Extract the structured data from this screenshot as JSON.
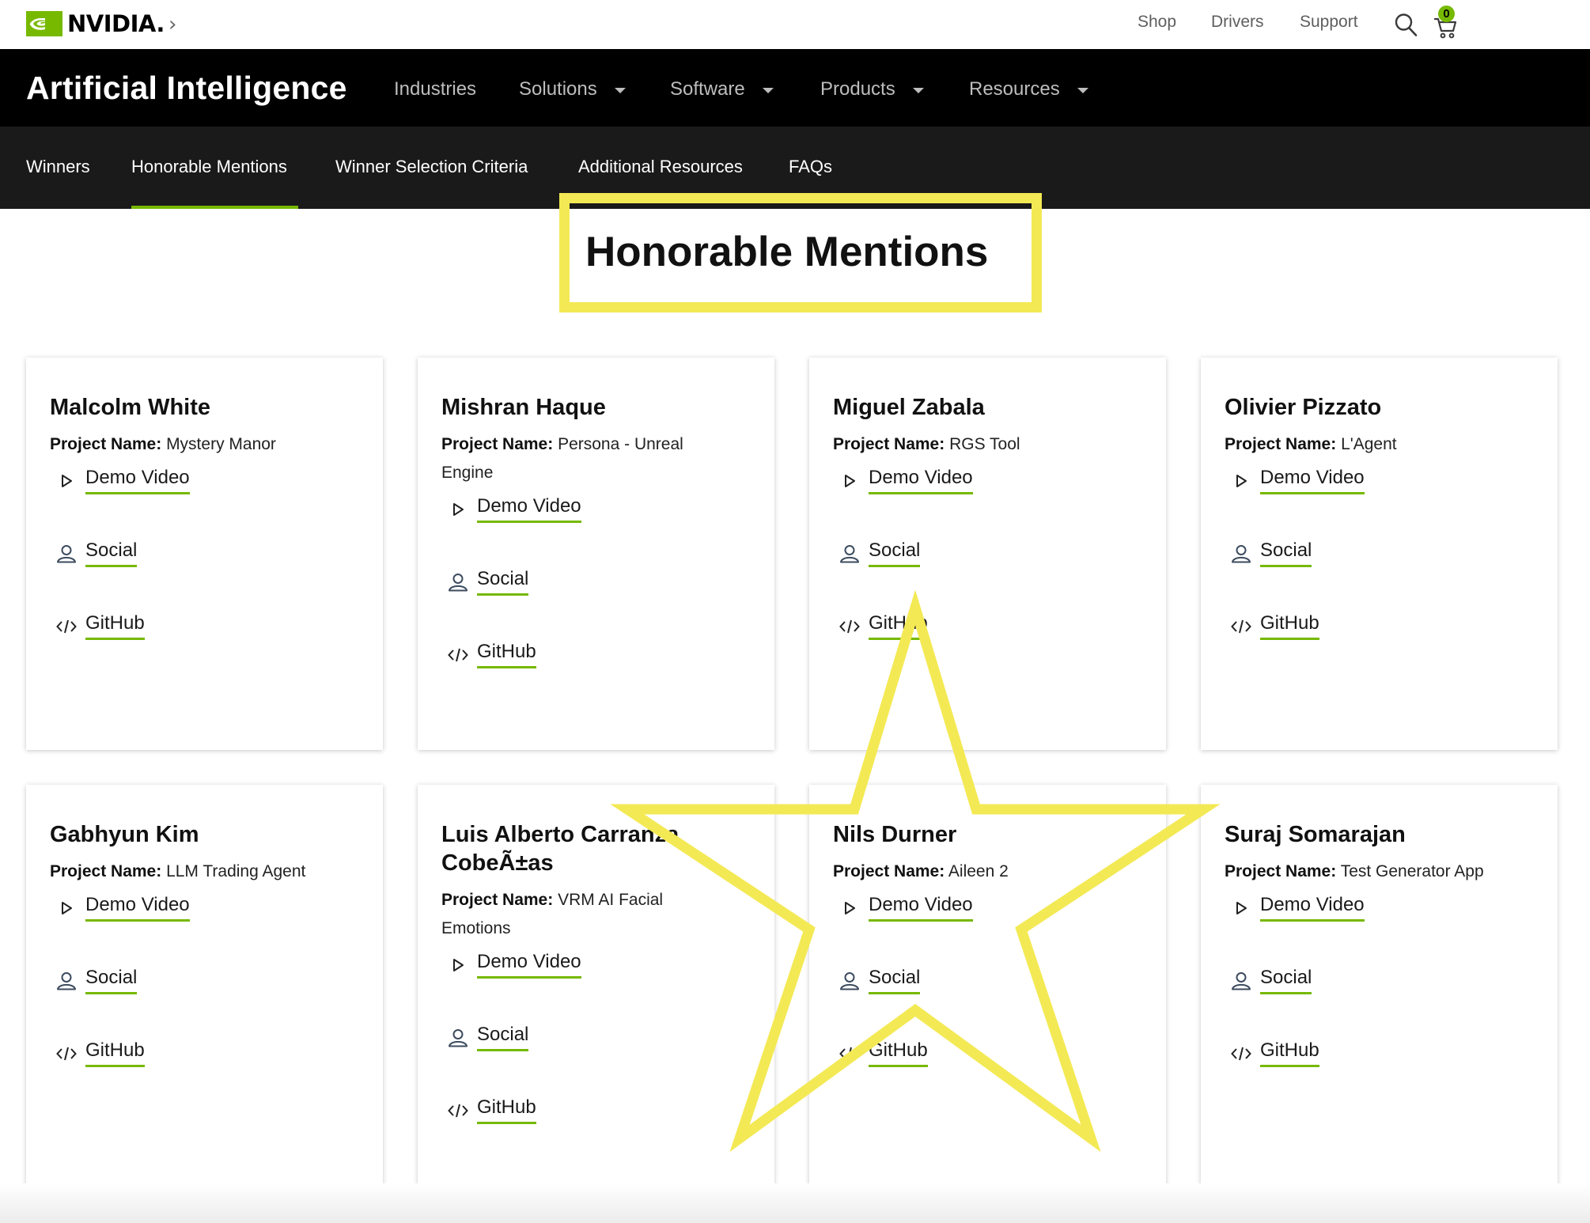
{
  "header": {
    "logo_text": "NVIDIA.",
    "breadcrumb_chevron": "›",
    "utility_links": [
      "Shop",
      "Drivers",
      "Support"
    ],
    "cart_count": "0"
  },
  "mainnav": {
    "title": "Artificial Intelligence",
    "items": [
      {
        "label": "Industries",
        "has_dropdown": false
      },
      {
        "label": "Solutions",
        "has_dropdown": true
      },
      {
        "label": "Software",
        "has_dropdown": true
      },
      {
        "label": "Products",
        "has_dropdown": true
      },
      {
        "label": "Resources",
        "has_dropdown": true
      }
    ]
  },
  "subnav": {
    "items": [
      "Winners",
      "Honorable Mentions",
      "Winner Selection Criteria",
      "Additional Resources",
      "FAQs"
    ],
    "active": "Honorable Mentions"
  },
  "page": {
    "title": "Honorable Mentions"
  },
  "labels": {
    "project_name": "Project Name:",
    "demo": "Demo Video",
    "social": "Social",
    "github": "GitHub"
  },
  "cards": [
    {
      "name": "Malcolm White",
      "project": "Mystery Manor"
    },
    {
      "name": "Mishran Haque",
      "project": "Persona - Unreal Engine"
    },
    {
      "name": "Miguel Zabala",
      "project": "RGS Tool"
    },
    {
      "name": "Olivier Pizzato",
      "project": "L'Agent"
    },
    {
      "name": "Gabhyun Kim",
      "project": "LLM Trading Agent"
    },
    {
      "name": "Luis Alberto Carranza CobeÃ±as",
      "project": "VRM AI Facial Emotions"
    },
    {
      "name": "Nils Durner",
      "project": "Aileen 2"
    },
    {
      "name": "Suraj Somarajan",
      "project": "Test Generator App"
    }
  ],
  "colors": {
    "accent": "#76b900",
    "annotation": "#f3e954",
    "nav_bg": "#000000",
    "subnav_bg": "#1a1a1a"
  },
  "icons": [
    "nvidia-logo-icon",
    "chevron-right-icon",
    "search-icon",
    "cart-icon",
    "caret-down-icon",
    "play-icon",
    "user-icon",
    "code-icon",
    "star-annotation"
  ]
}
